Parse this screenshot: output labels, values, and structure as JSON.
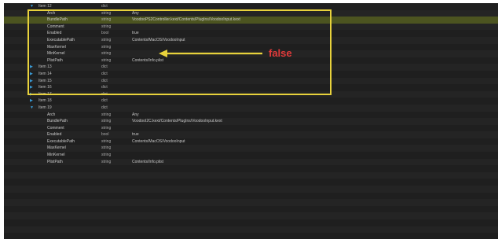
{
  "annotation": {
    "text": "false",
    "arrow_color": "#e8d23c",
    "text_color": "#e03a3a",
    "box_color": "#e8d23c"
  },
  "colors": {
    "highlight_row": "#4c5420",
    "disclosure": "#3a9bd6"
  },
  "rows": [
    {
      "kind": "item",
      "key": "Item 12",
      "type": "dict",
      "value": "",
      "open": true
    },
    {
      "kind": "child",
      "key": "Arch",
      "type": "string",
      "value": "Any"
    },
    {
      "kind": "child",
      "key": "BundlePath",
      "type": "string",
      "value": "VoodooPS2Controller.kext/Contents/PlugIns/VoodooInput.kext",
      "highlight": true
    },
    {
      "kind": "child",
      "key": "Comment",
      "type": "string",
      "value": ""
    },
    {
      "kind": "child",
      "key": "Enabled",
      "type": "bool",
      "value": "true"
    },
    {
      "kind": "child",
      "key": "ExecutablePath",
      "type": "string",
      "value": "Contents/MacOS/VoodooInput"
    },
    {
      "kind": "child",
      "key": "MaxKernel",
      "type": "string",
      "value": ""
    },
    {
      "kind": "child",
      "key": "MinKernel",
      "type": "string",
      "value": ""
    },
    {
      "kind": "child",
      "key": "PlistPath",
      "type": "string",
      "value": "Contents/Info.plist"
    },
    {
      "kind": "item",
      "key": "Item 13",
      "type": "dict",
      "value": "",
      "open": false
    },
    {
      "kind": "item",
      "key": "Item 14",
      "type": "dict",
      "value": "",
      "open": false
    },
    {
      "kind": "item",
      "key": "Item 15",
      "type": "dict",
      "value": "",
      "open": false
    },
    {
      "kind": "item",
      "key": "Item 16",
      "type": "dict",
      "value": "",
      "open": false
    },
    {
      "kind": "item",
      "key": "Item 17",
      "type": "dict",
      "value": "",
      "open": false
    },
    {
      "kind": "item",
      "key": "Item 18",
      "type": "dict",
      "value": "",
      "open": false
    },
    {
      "kind": "item",
      "key": "Item 19",
      "type": "dict",
      "value": "",
      "open": true
    },
    {
      "kind": "child",
      "key": "Arch",
      "type": "string",
      "value": "Any"
    },
    {
      "kind": "child",
      "key": "BundlePath",
      "type": "string",
      "value": "VoodooI2C.kext/Contents/PlugIns/VoodooInput.kext"
    },
    {
      "kind": "child",
      "key": "Comment",
      "type": "string",
      "value": ""
    },
    {
      "kind": "child",
      "key": "Enabled",
      "type": "bool",
      "value": "true"
    },
    {
      "kind": "child",
      "key": "ExecutablePath",
      "type": "string",
      "value": "Contents/MacOS/VoodooInput"
    },
    {
      "kind": "child",
      "key": "MaxKernel",
      "type": "string",
      "value": ""
    },
    {
      "kind": "child",
      "key": "MinKernel",
      "type": "string",
      "value": ""
    },
    {
      "kind": "child",
      "key": "PlistPath",
      "type": "string",
      "value": "Contents/Info.plist"
    },
    {
      "kind": "empty",
      "key": "",
      "type": "",
      "value": ""
    },
    {
      "kind": "empty",
      "key": "",
      "type": "",
      "value": ""
    },
    {
      "kind": "empty",
      "key": "",
      "type": "",
      "value": ""
    },
    {
      "kind": "empty",
      "key": "",
      "type": "",
      "value": ""
    },
    {
      "kind": "empty",
      "key": "",
      "type": "",
      "value": ""
    },
    {
      "kind": "empty",
      "key": "",
      "type": "",
      "value": ""
    },
    {
      "kind": "empty",
      "key": "",
      "type": "",
      "value": ""
    },
    {
      "kind": "empty",
      "key": "",
      "type": "",
      "value": ""
    },
    {
      "kind": "empty",
      "key": "",
      "type": "",
      "value": ""
    },
    {
      "kind": "empty",
      "key": "",
      "type": "",
      "value": ""
    },
    {
      "kind": "empty",
      "key": "",
      "type": "",
      "value": ""
    }
  ]
}
